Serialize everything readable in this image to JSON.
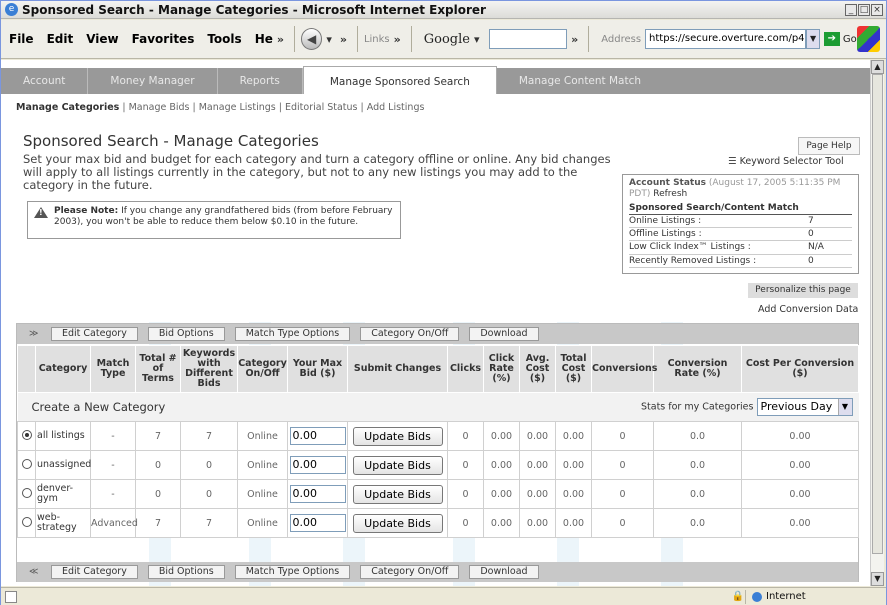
{
  "window": {
    "title": "Sponsored Search - Manage Categories - Microsoft Internet Explorer"
  },
  "browser": {
    "menu": [
      "File",
      "Edit",
      "View",
      "Favorites",
      "Tools",
      "He"
    ],
    "links_label": "Links",
    "google_label": "Google",
    "address_label": "Address",
    "address_value": "https://secure.overture.com/p4",
    "go_label": "Go"
  },
  "nav": {
    "tabs": [
      "Account",
      "Money Manager",
      "Reports",
      "Manage Sponsored Search",
      "Manage Content Match"
    ],
    "active_tab": "Manage Sponsored Search"
  },
  "subnav": {
    "current": "Manage Categories",
    "items": [
      "Manage Bids",
      "Manage Listings",
      "Editorial Status",
      "Add Listings"
    ]
  },
  "page": {
    "title": "Sponsored Search - Manage Categories",
    "intro": "Set your max bid and budget for each category and turn a category offline or online. Any bid changes will apply to all listings currently in the category, but not to any new listings you may add to the category in the future.",
    "help_button": "Page Help",
    "keyword_tool": "Keyword Selector Tool",
    "note_label": "Please Note:",
    "note_text": "If you change any grandfathered bids (from before February 2003), you won't be able to reduce them below $0.10 in the future.",
    "personalize": "Personalize this page",
    "add_conversion": "Add Conversion Data"
  },
  "account_status": {
    "label": "Account Status",
    "timestamp": "(August 17, 2005 5:11:35 PM PDT)",
    "refresh": "Refresh",
    "section": "Sponsored Search/Content Match",
    "rows": [
      {
        "label": "Online Listings :",
        "value": "7"
      },
      {
        "label": "Offline Listings :",
        "value": "0"
      },
      {
        "label": "Low Click Index™ Listings :",
        "value": "N/A"
      },
      {
        "label": "Recently Removed Listings :",
        "value": "0"
      }
    ]
  },
  "toolbar_buttons": [
    "Edit Category",
    "Bid Options",
    "Match Type Options",
    "Category On/Off",
    "Download"
  ],
  "table": {
    "columns": [
      "Category",
      "Match Type",
      "Total # of Terms",
      "Keywords with Different Bids",
      "Category On/Off",
      "Your Max Bid ($)",
      "Submit Changes",
      "Clicks",
      "Click Rate (%)",
      "Avg. Cost ($)",
      "Total Cost ($)",
      "Conversions",
      "Conversion Rate (%)",
      "Cost Per Conversion ($)"
    ],
    "create_label": "Create a New Category",
    "stats_label": "Stats for my Categories",
    "stats_period": "Previous Day",
    "update_label": "Update Bids",
    "rows": [
      {
        "category": "all listings",
        "match": "-",
        "terms": "7",
        "kw_diff": "7",
        "status": "Online",
        "bid": "0.00",
        "clicks": "0",
        "click_rate": "0.00",
        "avg_cost": "0.00",
        "total_cost": "0.00",
        "conv": "0",
        "conv_rate": "0.0",
        "cpc": "0.00",
        "selected": true
      },
      {
        "category": "unassigned",
        "match": "-",
        "terms": "0",
        "kw_diff": "0",
        "status": "Online",
        "bid": "0.00",
        "clicks": "0",
        "click_rate": "0.00",
        "avg_cost": "0.00",
        "total_cost": "0.00",
        "conv": "0",
        "conv_rate": "0.0",
        "cpc": "0.00",
        "selected": false
      },
      {
        "category": "denver-gym",
        "match": "-",
        "terms": "0",
        "kw_diff": "0",
        "status": "Online",
        "bid": "0.00",
        "clicks": "0",
        "click_rate": "0.00",
        "avg_cost": "0.00",
        "total_cost": "0.00",
        "conv": "0",
        "conv_rate": "0.0",
        "cpc": "0.00",
        "selected": false
      },
      {
        "category": "web-strategy",
        "match": "Advanced",
        "terms": "7",
        "kw_diff": "7",
        "status": "Online",
        "bid": "0.00",
        "clicks": "0",
        "click_rate": "0.00",
        "avg_cost": "0.00",
        "total_cost": "0.00",
        "conv": "0",
        "conv_rate": "0.0",
        "cpc": "0.00",
        "selected": false
      }
    ]
  },
  "statusbar": {
    "zone": "Internet"
  }
}
